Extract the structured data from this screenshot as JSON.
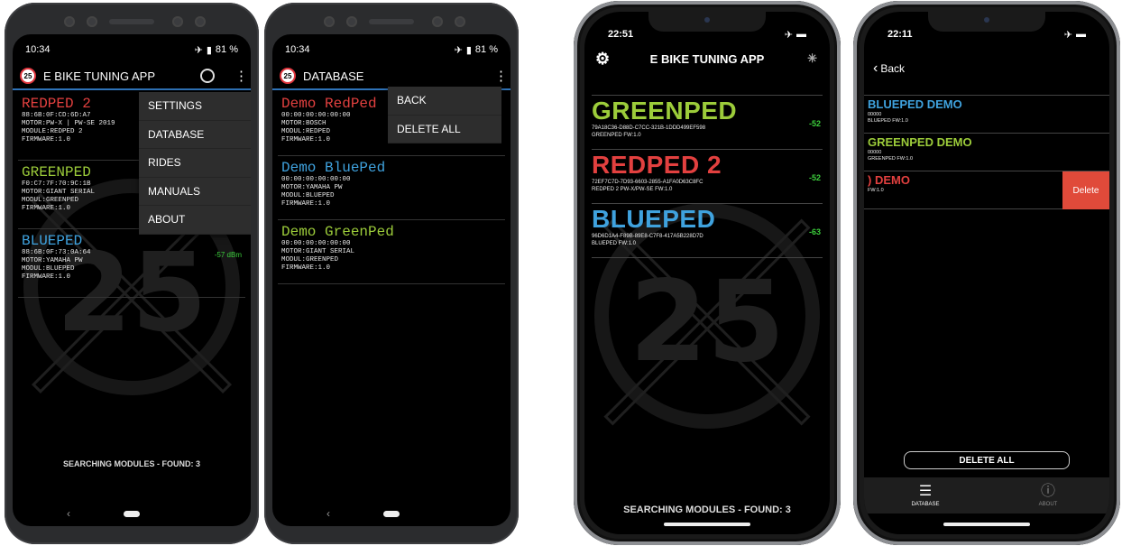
{
  "colors": {
    "red": "#e2403f",
    "green": "#9ccc3a",
    "blue": "#3fa2de",
    "accent": "#2f73b8",
    "rssi_green": "#3ccf3c"
  },
  "watermark_number": "25",
  "screen1": {
    "status": {
      "time": "10:34",
      "battery": "81 %"
    },
    "appbar": {
      "badge": "25",
      "title": "E BIKE TUNING APP"
    },
    "modules": [
      {
        "name": "REDPED 2",
        "color": "red",
        "lines": [
          "88:6B:0F:CD:6D:A7",
          "MOTOR:PW-X | PW-SE 2019",
          "MODULE:REDPED 2",
          "FIRMWARE:1.0"
        ],
        "rssi": ""
      },
      {
        "name": "GREENPED",
        "color": "green",
        "lines": [
          "F0:C7:7F:70:9C:1B",
          "MOTOR:GIANT SERIAL",
          "MODUL:GREENPED",
          "FIRMWARE:1.0"
        ],
        "rssi": ""
      },
      {
        "name": "BLUEPED",
        "color": "blue",
        "lines": [
          "88:6B:0F:73:0A:64",
          "MOTOR:YAMAHA PW",
          "MODUL:BLUEPED",
          "FIRMWARE:1.0"
        ],
        "rssi": "-57 dBm"
      }
    ],
    "menu": [
      "SETTINGS",
      "DATABASE",
      "RIDES",
      "MANUALS",
      "ABOUT"
    ],
    "footer": "SEARCHING MODULES - FOUND: 3"
  },
  "screen2": {
    "status": {
      "time": "10:34",
      "battery": "81 %"
    },
    "appbar": {
      "badge": "25",
      "title": "DATABASE"
    },
    "modules": [
      {
        "name": "Demo RedPed",
        "color": "red",
        "lines": [
          "00:00:00:00:00:00",
          "MOTOR:BOSCH",
          "MODUL:REDPED",
          "FIRMWARE:1.0"
        ]
      },
      {
        "name": "Demo BluePed",
        "color": "blue",
        "lines": [
          "00:00:00:00:00:00",
          "MOTOR:YAMAHA PW",
          "MODUL:BLUEPED",
          "FIRMWARE:1.0"
        ]
      },
      {
        "name": "Demo GreenPed",
        "color": "green",
        "lines": [
          "00:00:00:00:00:00",
          "MOTOR:GIANT SERIAL",
          "MODUL:GREENPED",
          "FIRMWARE:1.0"
        ]
      }
    ],
    "menu": [
      "BACK",
      "DELETE ALL"
    ]
  },
  "screen3": {
    "time": "22:51",
    "title": "E BIKE TUNING APP",
    "modules": [
      {
        "name": "GREENPED",
        "color": "green",
        "uuid": "79A18C36-D88D-C7CC-321B-1DDD499EF598",
        "info": "GREENPED FW:1.0",
        "rssi": "-52"
      },
      {
        "name": "REDPED 2",
        "color": "red",
        "uuid": "72EF7C7D-7D93-6603-2855-A1FA0D63C8FC",
        "info": "REDPED 2 PW-X/PW-SE FW:1.0",
        "rssi": "-52"
      },
      {
        "name": "BLUEPED",
        "color": "blue",
        "uuid": "96D6D1A4-F89B-89E8-C7F8-417A5B228D7D",
        "info": "BLUEPED FW:1.0",
        "rssi": "-63"
      }
    ],
    "footer": "SEARCHING MODULES - FOUND: 3"
  },
  "screen4": {
    "time": "22:11",
    "back_label": "Back",
    "entries": [
      {
        "name": "BLUEPED DEMO",
        "color": "blue",
        "lines": [
          "00000",
          "BLUEPED FW:1.0"
        ]
      },
      {
        "name": "GREENPED DEMO",
        "color": "green",
        "lines": [
          "00000",
          "GREENPED FW:1.0"
        ]
      },
      {
        "name": ") DEMO",
        "color": "red",
        "lines": [
          "",
          "FW:1.0"
        ],
        "swiped": true
      }
    ],
    "delete_label": "Delete",
    "delete_all_label": "DELETE ALL",
    "tabs": [
      {
        "label": "DATABASE",
        "icon": "database-icon"
      },
      {
        "label": "ABOUT",
        "icon": "info-icon"
      }
    ]
  }
}
